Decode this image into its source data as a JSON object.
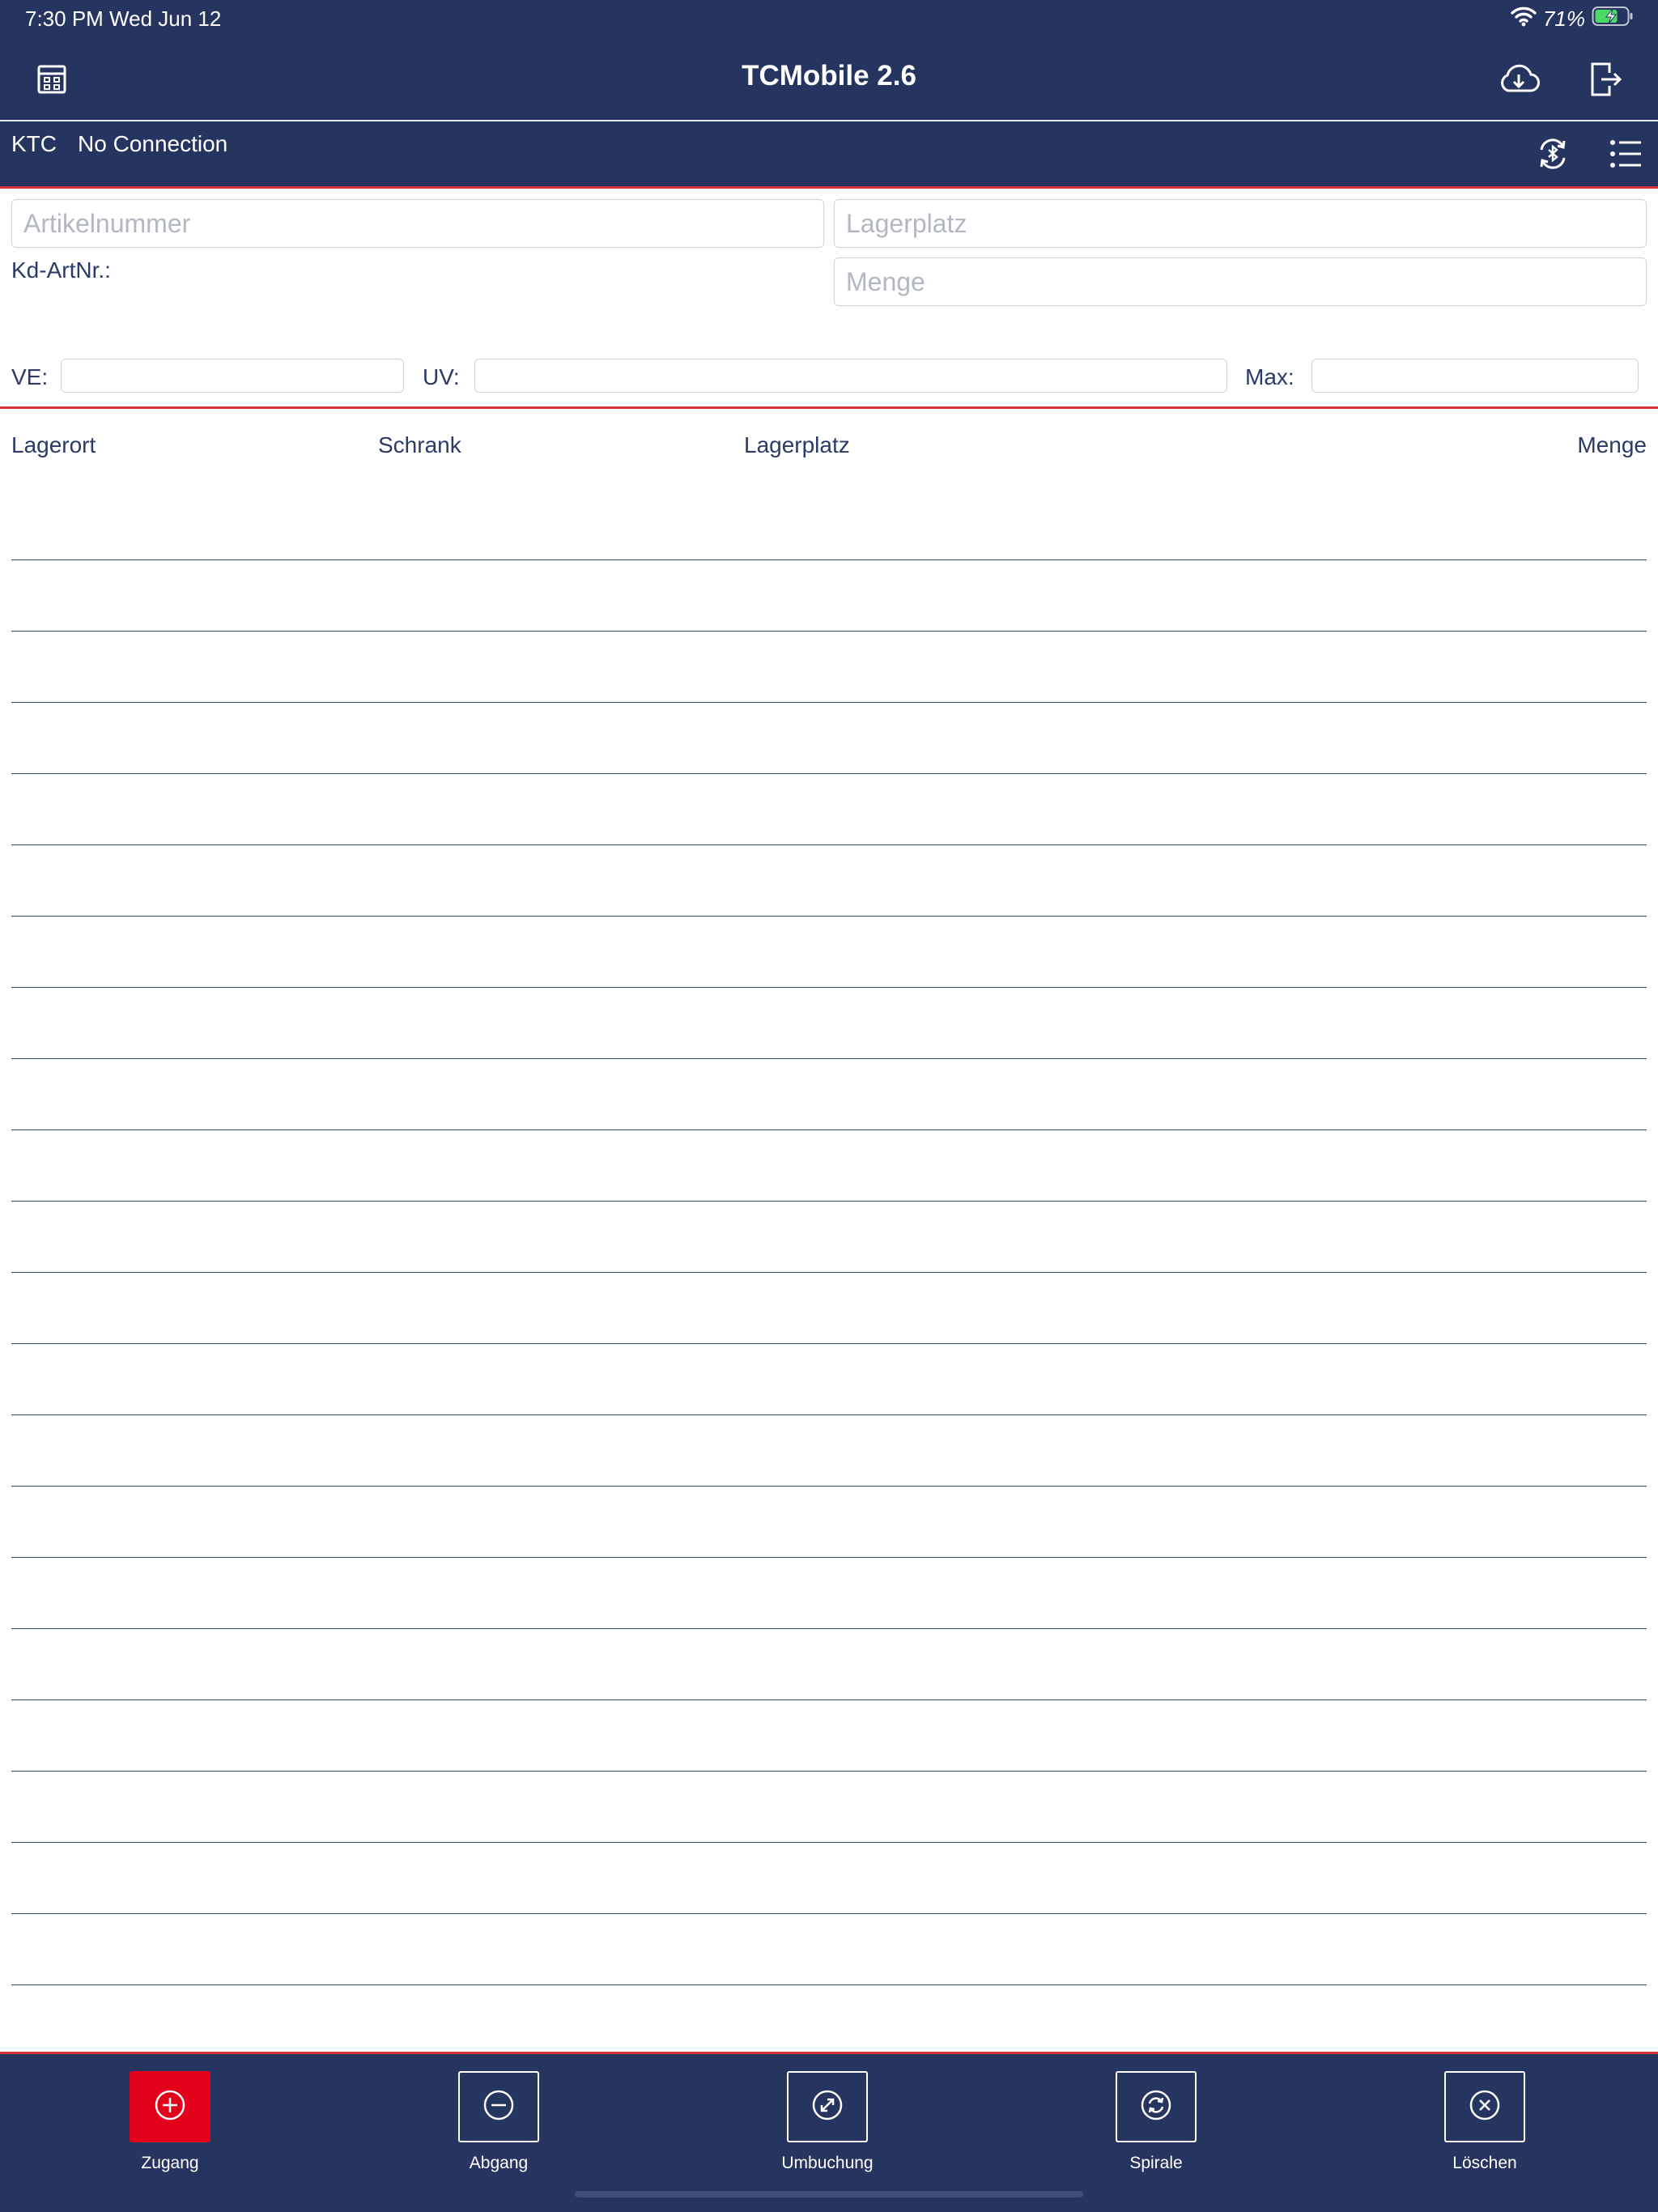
{
  "status_bar": {
    "time_date": "7:30 PM   Wed Jun 12",
    "battery_percent": "71%",
    "icons": [
      "wifi-icon",
      "battery-charging-icon"
    ]
  },
  "nav": {
    "title": "TCMobile 2.6",
    "left_icon": "calculator-icon",
    "right_icons": [
      "cloud-download-icon",
      "logout-icon"
    ]
  },
  "subbar": {
    "company": "KTC",
    "connection": "No Connection",
    "right_icons": [
      "bluetooth-sync-icon",
      "list-menu-icon"
    ]
  },
  "form": {
    "artikelnummer": {
      "placeholder": "Artikelnummer",
      "value": ""
    },
    "lagerplatz": {
      "placeholder": "Lagerplatz",
      "value": ""
    },
    "menge": {
      "placeholder": "Menge",
      "value": ""
    },
    "kd_artnr_label": "Kd-ArtNr.:",
    "ve_label": "VE:",
    "uv_label": "UV:",
    "max_label": "Max:"
  },
  "table": {
    "columns": [
      "Lagerort",
      "Schrank",
      "Lagerplatz",
      "Menge"
    ],
    "rows": [
      "",
      "",
      "",
      "",
      "",
      "",
      "",
      "",
      "",
      "",
      "",
      "",
      "",
      "",
      "",
      "",
      "",
      "",
      "",
      "",
      "",
      ""
    ]
  },
  "toolbar": {
    "buttons": [
      {
        "label": "Zugang",
        "icon": "plus-circle-icon",
        "active": true
      },
      {
        "label": "Abgang",
        "icon": "minus-circle-icon",
        "active": false
      },
      {
        "label": "Umbuchung",
        "icon": "transfer-circle-icon",
        "active": false
      },
      {
        "label": "Spirale",
        "icon": "refresh-circle-icon",
        "active": false
      },
      {
        "label": "Löschen",
        "icon": "close-circle-icon",
        "active": false
      }
    ]
  },
  "colors": {
    "navy": "#253560",
    "accent_red": "#e2001a",
    "divider_red": "#d8323a",
    "text": "#2b3a67"
  }
}
